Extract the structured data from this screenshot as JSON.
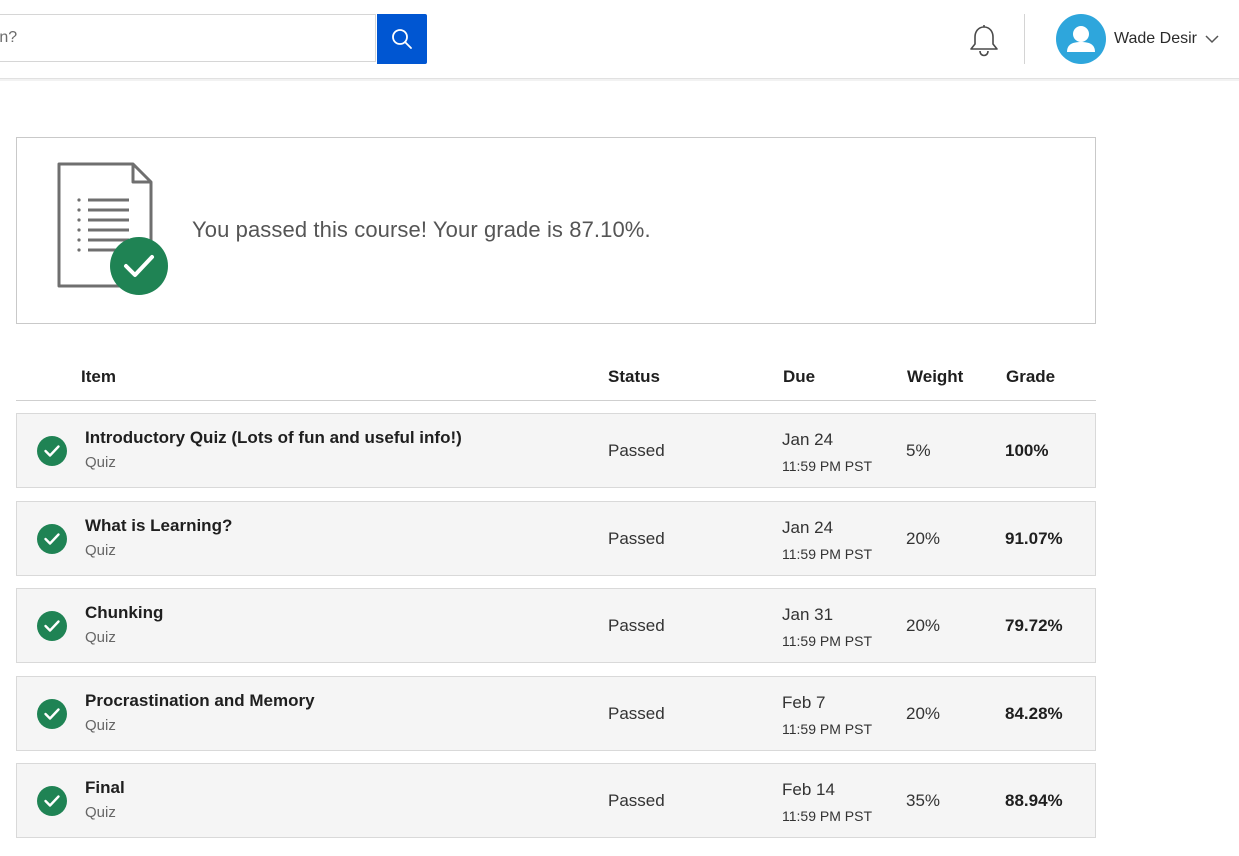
{
  "header": {
    "search_placeholder": "rn?",
    "user_name": "Wade Desir"
  },
  "icons": {
    "search": "search-icon",
    "bell": "bell-icon",
    "avatar": "user-avatar-icon",
    "chevron": "chevron-down-icon",
    "document": "document-check-icon",
    "check": "check-circle-icon"
  },
  "colors": {
    "brand_blue": "#0056d2",
    "avatar_blue": "#2ea6dc",
    "success_green": "#1f8354"
  },
  "banner": {
    "message": "You passed this course! Your grade is 87.10%."
  },
  "table": {
    "headers": {
      "item": "Item",
      "status": "Status",
      "due": "Due",
      "weight": "Weight",
      "grade": "Grade"
    },
    "rows": [
      {
        "title": "Introductory Quiz (Lots of fun and useful info!)",
        "type": "Quiz",
        "status": "Passed",
        "due_date": "Jan 24",
        "due_time": "11:59 PM PST",
        "weight": "5%",
        "grade": "100%"
      },
      {
        "title": "What is Learning?",
        "type": "Quiz",
        "status": "Passed",
        "due_date": "Jan 24",
        "due_time": "11:59 PM PST",
        "weight": "20%",
        "grade": "91.07%"
      },
      {
        "title": "Chunking",
        "type": "Quiz",
        "status": "Passed",
        "due_date": "Jan 31",
        "due_time": "11:59 PM PST",
        "weight": "20%",
        "grade": "79.72%"
      },
      {
        "title": "Procrastination and Memory",
        "type": "Quiz",
        "status": "Passed",
        "due_date": "Feb 7",
        "due_time": "11:59 PM PST",
        "weight": "20%",
        "grade": "84.28%"
      },
      {
        "title": "Final",
        "type": "Quiz",
        "status": "Passed",
        "due_date": "Feb 14",
        "due_time": "11:59 PM PST",
        "weight": "35%",
        "grade": "88.94%"
      }
    ]
  }
}
